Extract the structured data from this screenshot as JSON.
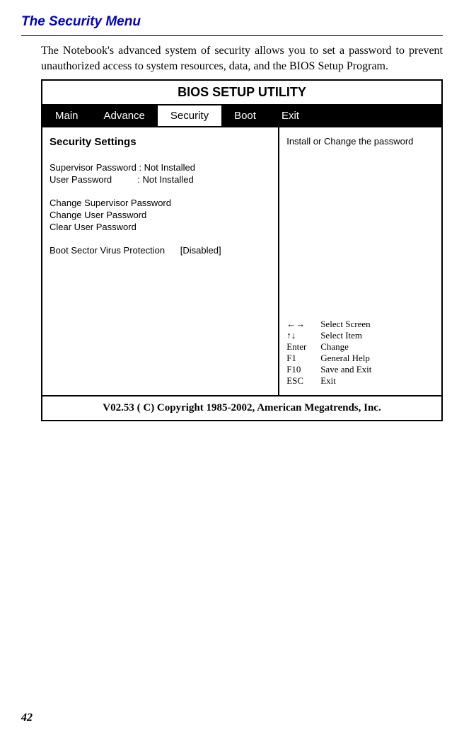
{
  "section_title": "The Security Menu",
  "intro": "The Notebook's advanced system of security allows you to set a password to prevent unauthorized access to system resources, data, and the BIOS Setup Program.",
  "bios": {
    "title": "BIOS SETUP UTILITY",
    "menu": {
      "items": [
        "Main",
        "Advance",
        "Security",
        "Boot",
        "Exit"
      ],
      "active": "Security"
    },
    "settings_heading": "Security Settings",
    "settings": {
      "supervisor_label": "Supervisor Password",
      "supervisor_value": "Not Installed",
      "user_label": "User Password",
      "user_value": "Not Installed",
      "change_supervisor": "Change Supervisor Password",
      "change_user": "Change User Password",
      "clear_user": "Clear User Password",
      "boot_sector_label": "Boot Sector Virus Protection",
      "boot_sector_value": "[Disabled]"
    },
    "help_text": "Install or Change the password",
    "legend": {
      "arrows_lr": "Select Screen",
      "arrows_ud": "Select Item",
      "enter_key": "Enter",
      "enter_label": "Change",
      "f1_key": "F1",
      "f1_label": "General Help",
      "f10_key": "F10",
      "f10_label": "Save and Exit",
      "esc_key": "ESC",
      "esc_label": "Exit"
    },
    "copyright": "V02.53  ( C) Copyright 1985-2002, American Megatrends, Inc."
  },
  "page_number": "42"
}
